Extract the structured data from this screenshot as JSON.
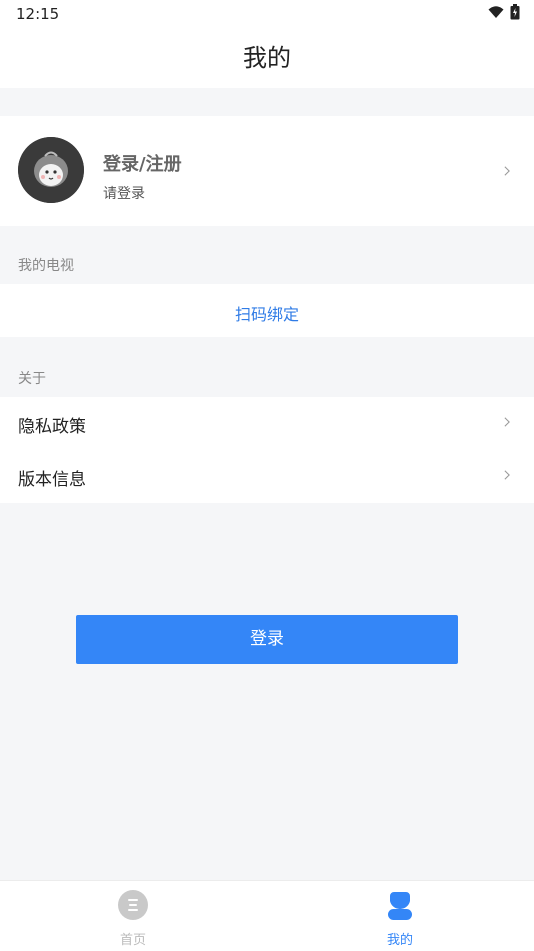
{
  "status": {
    "time": "12:15"
  },
  "header": {
    "title": "我的"
  },
  "profile": {
    "name": "登录/注册",
    "subtitle": "请登录"
  },
  "sections": {
    "tv": {
      "title": "我的电视",
      "scan_label": "扫码绑定"
    },
    "about": {
      "title": "关于",
      "items": [
        {
          "label": "隐私政策"
        },
        {
          "label": "版本信息"
        }
      ]
    }
  },
  "login_button": {
    "label": "登录"
  },
  "tabbar": {
    "items": [
      {
        "label": "首页",
        "icon": "home-icon",
        "active": false
      },
      {
        "label": "我的",
        "icon": "user-icon",
        "active": true
      }
    ]
  },
  "colors": {
    "accent": "#3486f7",
    "link": "#2f7be6",
    "background": "#f5f6f8"
  }
}
